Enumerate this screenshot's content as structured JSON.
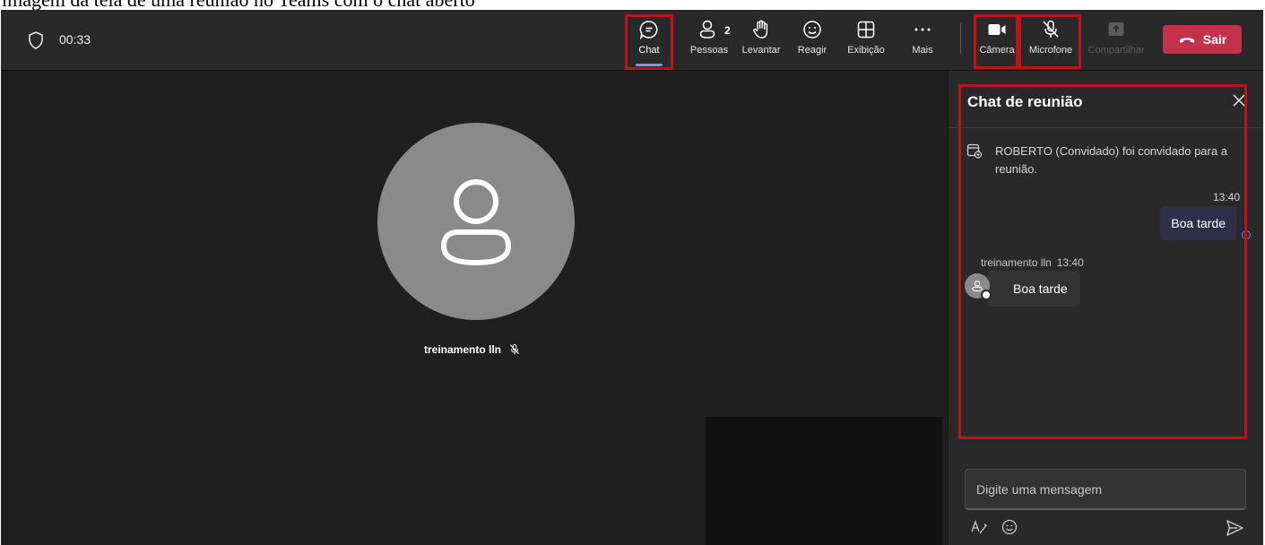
{
  "caption_fragment": "imagem da tela de uma reunião no Teams com o chat aberto",
  "meeting": {
    "timer": "00:33"
  },
  "toolbar": {
    "chat_label": "Chat",
    "people_label": "Pessoas",
    "people_count": "2",
    "raise_label": "Levantar",
    "react_label": "Reagir",
    "view_label": "Exibição",
    "more_label": "Mais",
    "camera_label": "Câmera",
    "mic_label": "Microfone",
    "share_label": "Compartilhar",
    "leave_label": "Sair"
  },
  "stage": {
    "participant_name": "treinamento lln"
  },
  "chat": {
    "title": "Chat de reunião",
    "system_message": "ROBERTO (Convidado) foi convidado para a reunião.",
    "messages": [
      {
        "mine": true,
        "time": "13:40",
        "text": "Boa tarde"
      },
      {
        "mine": false,
        "sender": "treinamento lln",
        "time": "13:40",
        "text": "Boa tarde"
      }
    ],
    "compose_placeholder": "Digite uma mensagem"
  },
  "colors": {
    "leave_button": "#c4314b",
    "highlight_box": "#c0121b",
    "active_tab_underline": "#8f8de3",
    "my_bubble": "#2f2f4a"
  }
}
